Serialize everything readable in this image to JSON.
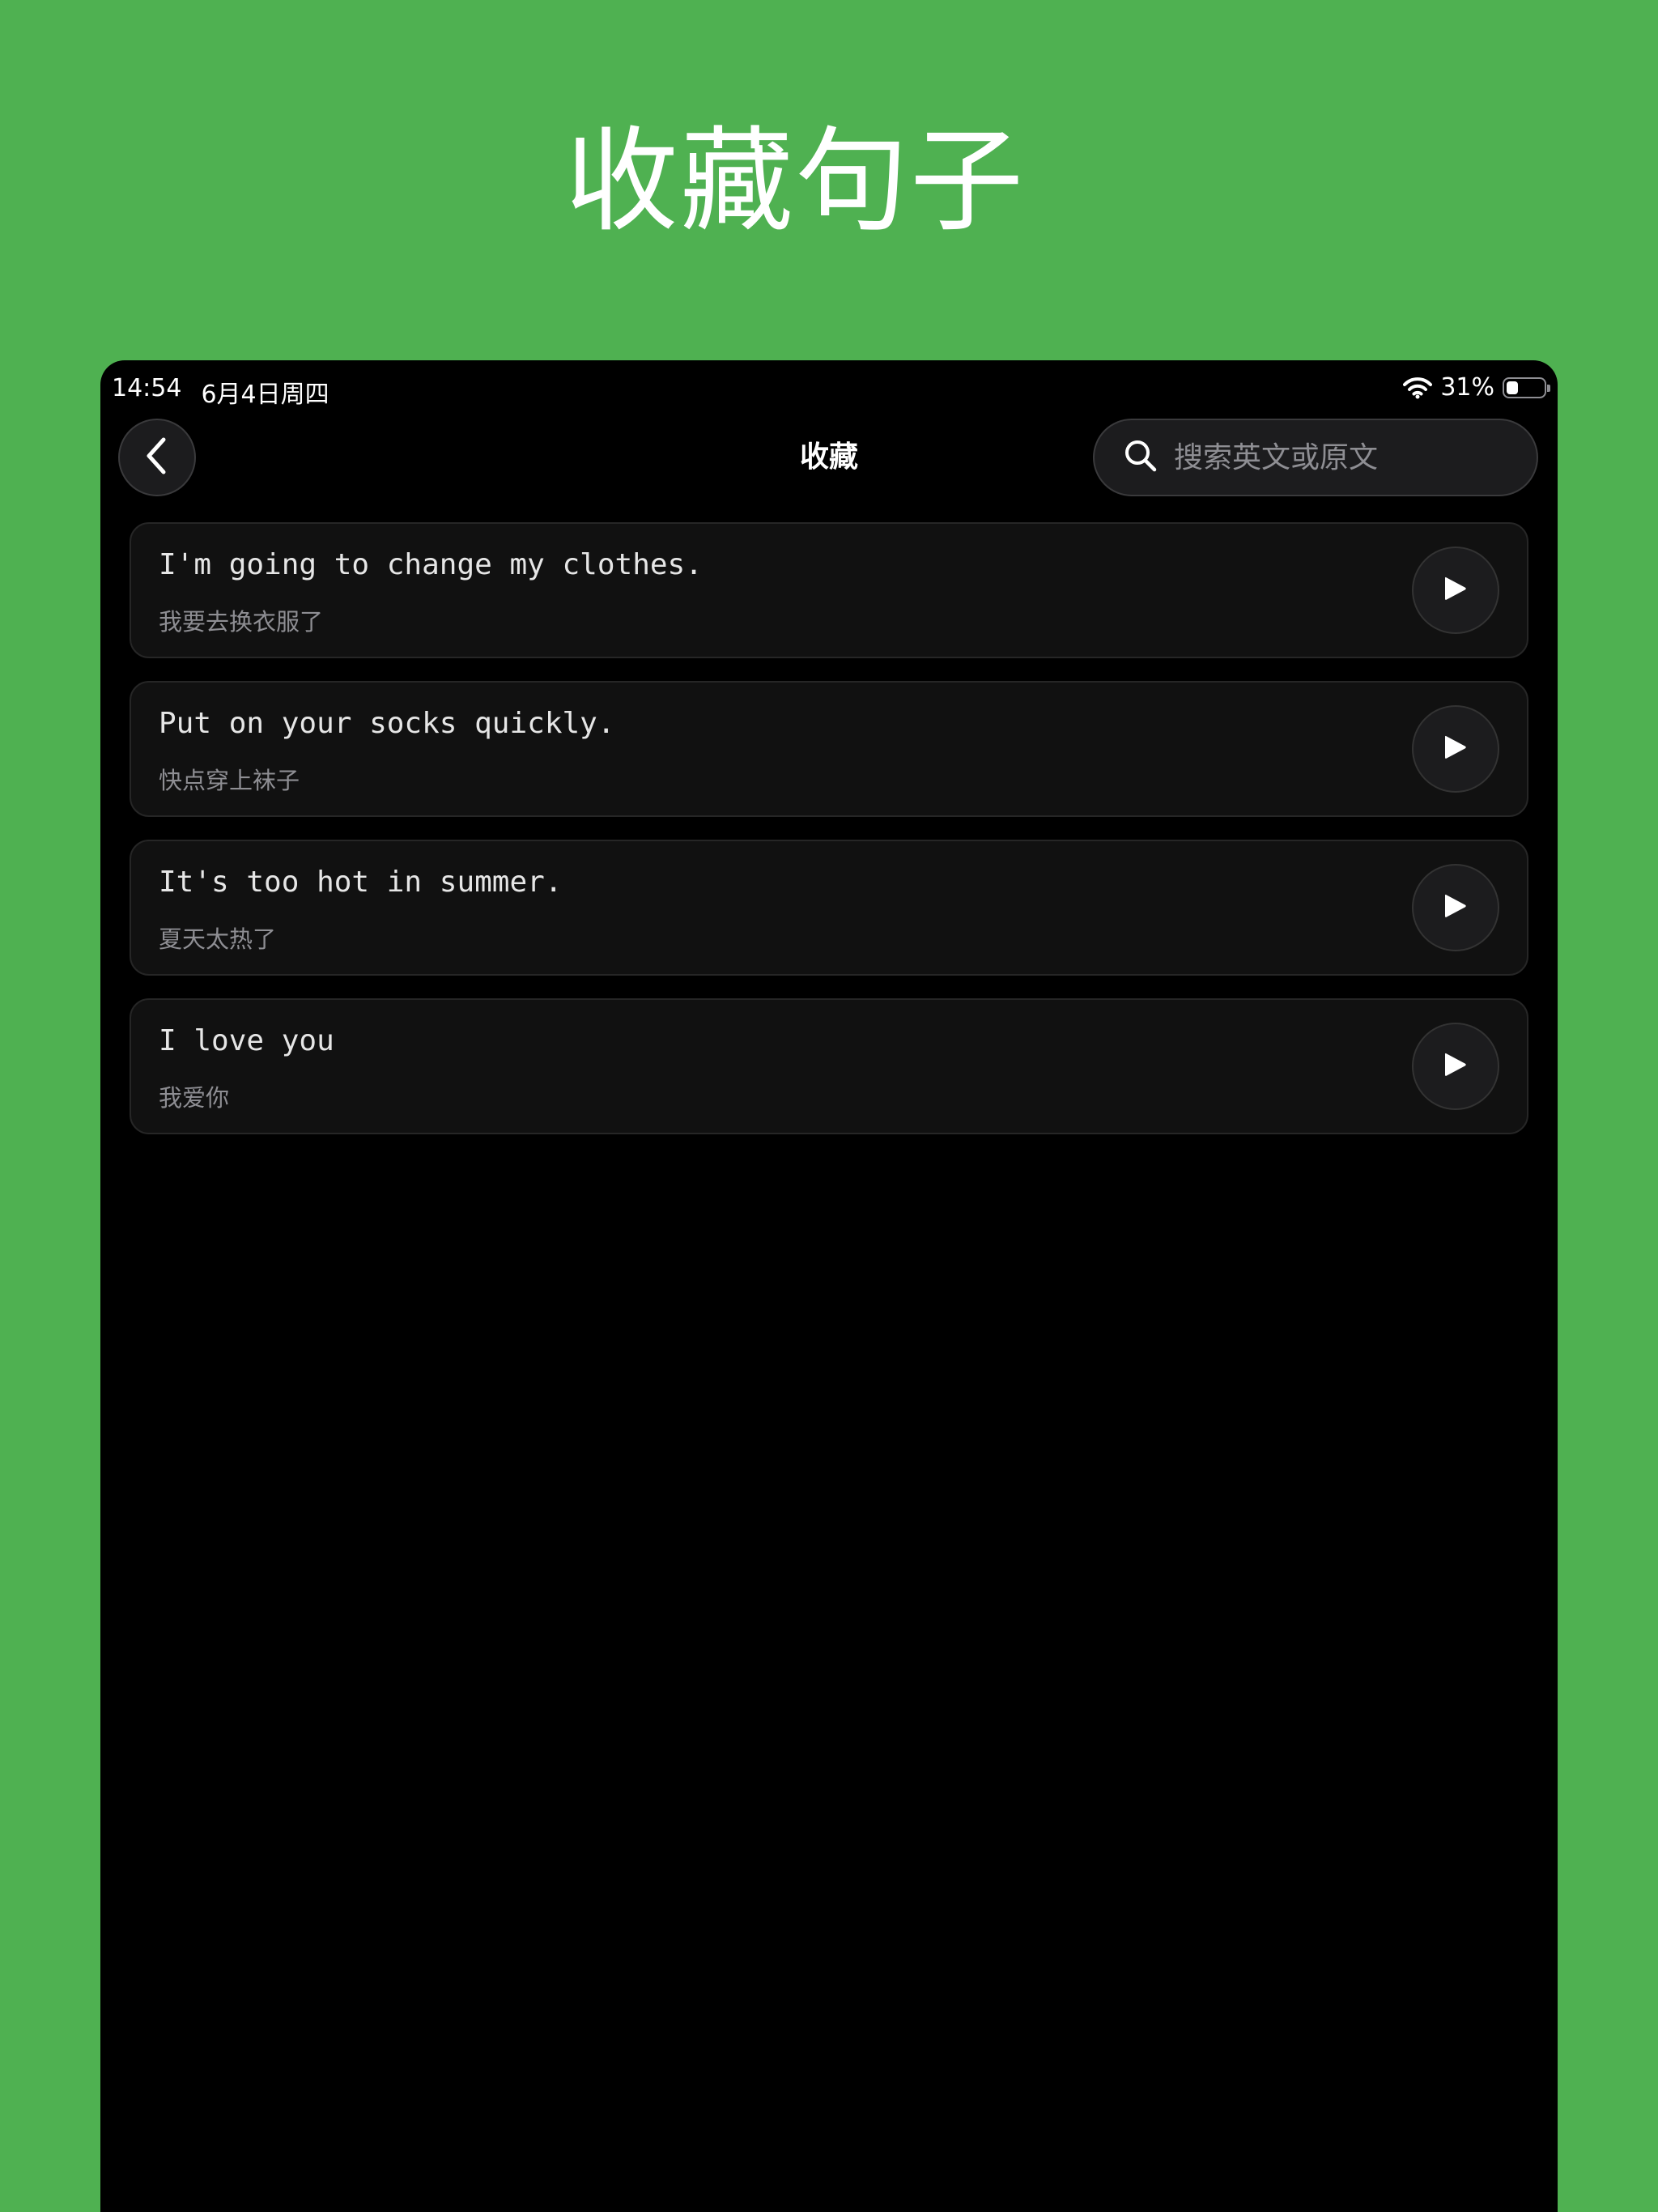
{
  "promo": {
    "title": "收藏句子"
  },
  "status_bar": {
    "time": "14:54",
    "date": "6月4日周四",
    "battery_text": "31%",
    "battery_level": 0.31
  },
  "nav": {
    "back_icon": "chevron-left-icon",
    "title": "收藏",
    "search_placeholder": "搜索英文或原文",
    "search_icon": "search-icon"
  },
  "sentences": [
    {
      "en": "I'm going to change my clothes.",
      "zh": "我要去换衣服了"
    },
    {
      "en": "Put on your socks quickly.",
      "zh": "快点穿上袜子"
    },
    {
      "en": "It's too hot in summer.",
      "zh": "夏天太热了"
    },
    {
      "en": "I love you",
      "zh": "我爱你"
    }
  ],
  "colors": {
    "background": "#4FB151",
    "screen": "#000000",
    "card": "#111111"
  }
}
